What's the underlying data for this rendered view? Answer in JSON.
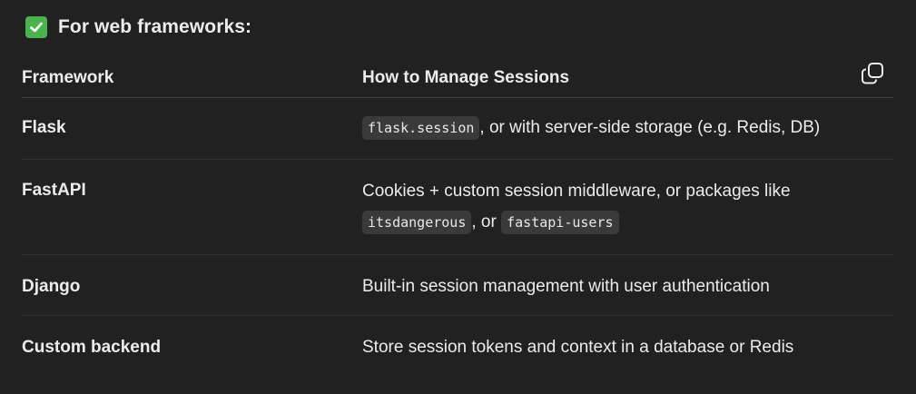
{
  "heading": {
    "icon": "check-box-icon",
    "text": "For web frameworks:"
  },
  "table": {
    "headers": [
      "Framework",
      "How to Manage Sessions"
    ],
    "rows": [
      {
        "framework": "Flask",
        "code1": "flask.session",
        "text1": ", or with server-side storage (e.g. Redis, DB)"
      },
      {
        "framework": "FastAPI",
        "text1": "Cookies + custom session middleware, or packages like",
        "code1": "itsdangerous",
        "text2": ", or",
        "code2": "fastapi-users"
      },
      {
        "framework": "Django",
        "text1": "Built-in session management with user authentication"
      },
      {
        "framework": "Custom backend",
        "text1": "Store session tokens and context in a database or Redis"
      }
    ]
  },
  "copy_icon": "copy-icon",
  "colors": {
    "background": "#212121",
    "text": "#ececec",
    "check_green": "#4bb34b",
    "code_bg": "#3a3a3a"
  }
}
